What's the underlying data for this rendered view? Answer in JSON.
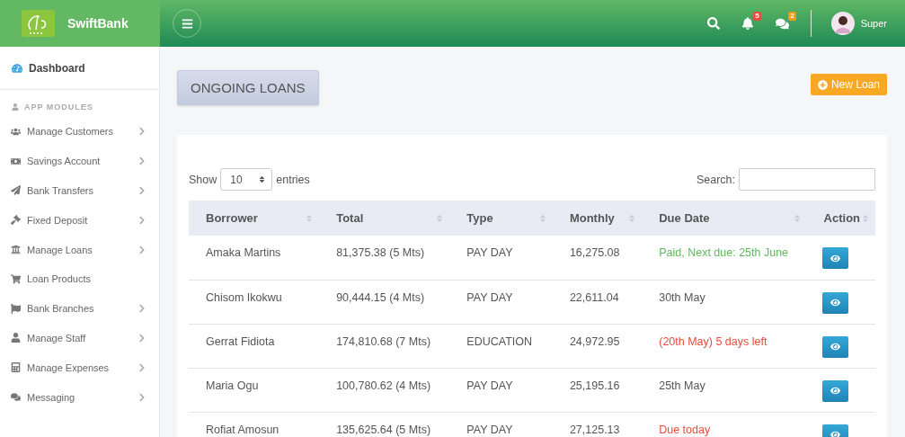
{
  "brand": {
    "name": "SwiftBank"
  },
  "header": {
    "notifications": "5",
    "messages": "2",
    "user": "Super"
  },
  "sidebar": {
    "dashboard": "Dashboard",
    "section": "APP MODULES",
    "items": [
      {
        "label": "Manage Customers",
        "has_submenu": true
      },
      {
        "label": "Savings Account",
        "has_submenu": true
      },
      {
        "label": "Bank Transfers",
        "has_submenu": true
      },
      {
        "label": "Fixed Deposit",
        "has_submenu": true
      },
      {
        "label": "Manage Loans",
        "has_submenu": true
      },
      {
        "label": "Loan Products",
        "has_submenu": false
      },
      {
        "label": "Bank Branches",
        "has_submenu": true
      },
      {
        "label": "Manage Staff",
        "has_submenu": true
      },
      {
        "label": "Manage Expenses",
        "has_submenu": true
      },
      {
        "label": "Messaging",
        "has_submenu": true
      }
    ]
  },
  "page": {
    "title": "ONGOING LOANS",
    "new_button": "New Loan"
  },
  "table": {
    "show_label": "Show",
    "page_size": "10",
    "entries_label": "entries",
    "search_label": "Search:",
    "columns": [
      "Borrower",
      "Total",
      "Type",
      "Monthly",
      "Due Date",
      "Action"
    ],
    "rows": [
      {
        "borrower": "Amaka Martins",
        "total": "81,375.38 (5 Mts)",
        "type": "PAY DAY",
        "monthly": "16,275.08",
        "due": "Paid, Next due: 25th June",
        "color": "#5cb85c"
      },
      {
        "borrower": "Chisom Ikokwu",
        "total": "90,444.15 (4 Mts)",
        "type": "PAY DAY",
        "monthly": "22,611.04",
        "due": "30th May",
        "color": "#555555"
      },
      {
        "borrower": "Gerrat Fidiota",
        "total": "174,810.68 (7 Mts)",
        "type": "EDUCATION",
        "monthly": "24,972.95",
        "due": "(20th May) 5 days left",
        "color": "#e74c3c"
      },
      {
        "borrower": "Maria Ogu",
        "total": "100,780.62 (4 Mts)",
        "type": "PAY DAY",
        "monthly": "25,195.16",
        "due": "25th May",
        "color": "#555555"
      },
      {
        "borrower": "Rofiat Amosun",
        "total": "135,625.64 (5 Mts)",
        "type": "PAY DAY",
        "monthly": "27,125.13",
        "due": "Due today",
        "color": "#e74c3c"
      }
    ]
  }
}
